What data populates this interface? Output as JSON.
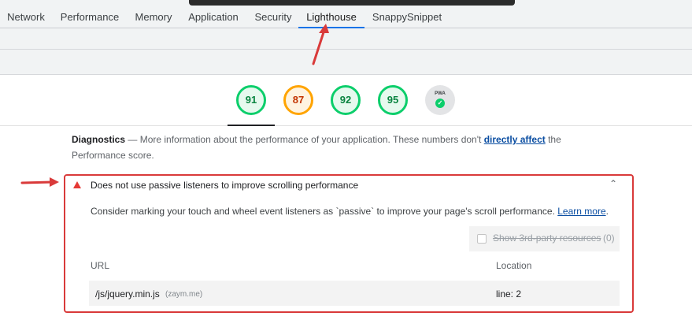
{
  "tabs": [
    {
      "label": "Network"
    },
    {
      "label": "Performance"
    },
    {
      "label": "Memory"
    },
    {
      "label": "Application"
    },
    {
      "label": "Security"
    },
    {
      "label": "Lighthouse",
      "active": true
    },
    {
      "label": "SnappySnippet"
    }
  ],
  "scores": [
    {
      "value": "91",
      "status": "pass"
    },
    {
      "value": "87",
      "status": "average"
    },
    {
      "value": "92",
      "status": "pass"
    },
    {
      "value": "95",
      "status": "pass"
    }
  ],
  "pwa": {
    "label": "PWA"
  },
  "diagnostics": {
    "title": "Diagnostics",
    "dash": "—",
    "text_before_link": "More information about the performance of your application. These numbers don't",
    "link": "directly affect",
    "text_after_link": "the Performance score."
  },
  "audit": {
    "title": "Does not use passive listeners to improve scrolling performance",
    "description": "Consider marking your touch and wheel event listeners as `passive` to improve your page's scroll performance.",
    "learn_more": "Learn more",
    "third_party_label": "Show 3rd-party resources",
    "third_party_count": "(0)",
    "columns": {
      "url": "URL",
      "location": "Location"
    },
    "rows": [
      {
        "url": "/js/jquery.min.js",
        "host": "(zaym.me)",
        "location": "line: 2"
      }
    ]
  },
  "colors": {
    "pass": "#0cce6b",
    "average": "#ffa400",
    "fail": "#e53935",
    "annotation": "#d93a3a",
    "link": "#0b4ea2"
  },
  "icons": [
    "fail-triangle-icon",
    "chevron-up-icon",
    "check-icon",
    "annotation-arrow-icon"
  ]
}
